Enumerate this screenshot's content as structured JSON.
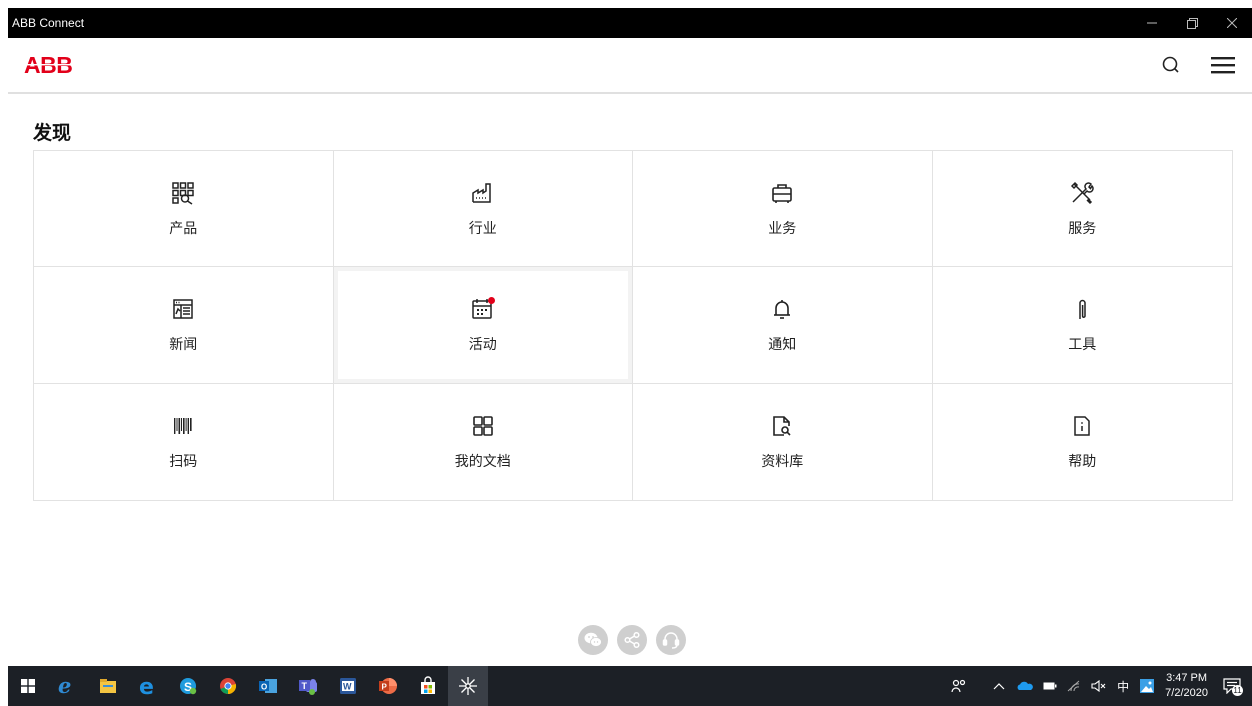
{
  "window": {
    "title": "ABB Connect",
    "controls": [
      "minimize",
      "restore",
      "close"
    ]
  },
  "header": {
    "logo_text": "ABB",
    "brand_color": "#e2001a"
  },
  "section": {
    "title": "发现"
  },
  "tiles": [
    {
      "label": "产品",
      "icon": "products-grid-icon"
    },
    {
      "label": "行业",
      "icon": "factory-icon"
    },
    {
      "label": "业务",
      "icon": "briefcase-icon"
    },
    {
      "label": "服务",
      "icon": "tools-icon"
    },
    {
      "label": "新闻",
      "icon": "newspaper-icon"
    },
    {
      "label": "活动",
      "icon": "calendar-icon",
      "has_badge": true
    },
    {
      "label": "通知",
      "icon": "bell-icon"
    },
    {
      "label": "工具",
      "icon": "paperclip-icon"
    },
    {
      "label": "扫码",
      "icon": "barcode-icon"
    },
    {
      "label": "我的文档",
      "icon": "apps-grid-icon"
    },
    {
      "label": "资料库",
      "icon": "document-search-icon"
    },
    {
      "label": "帮助",
      "icon": "info-document-icon"
    }
  ],
  "share": [
    "wechat-icon",
    "share-icon",
    "headset-icon"
  ],
  "taskbar": {
    "apps": [
      "windows-start-icon",
      "edge-legacy-icon",
      "file-explorer-icon",
      "internet-explorer-icon",
      "skype-icon",
      "chrome-icon",
      "outlook-icon",
      "teams-icon",
      "word-icon",
      "powerpoint-icon",
      "store-icon",
      "abb-connect-icon"
    ],
    "tray": {
      "ime": "中",
      "time": "3:47 PM",
      "date": "7/2/2020",
      "notification_count": "11"
    }
  }
}
